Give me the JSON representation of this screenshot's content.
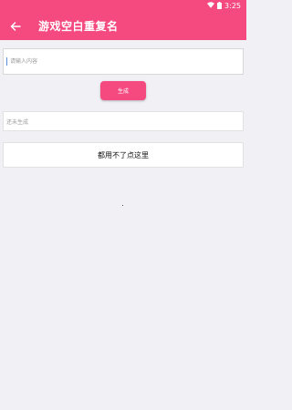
{
  "status_bar": {
    "time": "3:25"
  },
  "app_bar": {
    "title": "游戏空白重复名",
    "color": "#f54a80"
  },
  "input": {
    "placeholder": "请输入内容",
    "value": ""
  },
  "generate_button": {
    "label": "生成"
  },
  "result": {
    "text": "还未生成"
  },
  "fallback_button": {
    "label": "都用不了点这里"
  }
}
